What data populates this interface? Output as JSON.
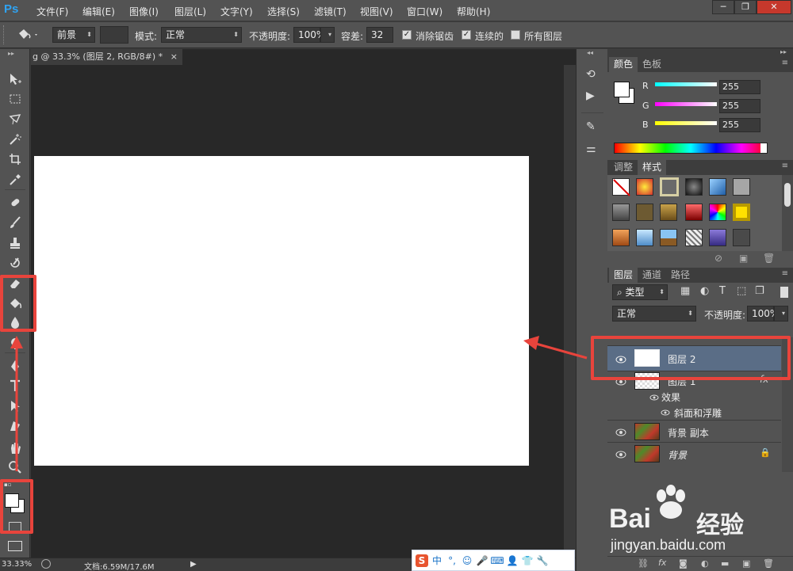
{
  "app": {
    "logo": "Ps",
    "menu": [
      "文件(F)",
      "编辑(E)",
      "图像(I)",
      "图层(L)",
      "文字(Y)",
      "选择(S)",
      "滤镜(T)",
      "视图(V)",
      "窗口(W)",
      "帮助(H)"
    ],
    "window_controls": [
      "─",
      "❐",
      "✕"
    ]
  },
  "options": {
    "fill_source": "前景",
    "mode_label": "模式:",
    "mode_value": "正常",
    "opacity_label": "不透明度:",
    "opacity_value": "100%",
    "tolerance_label": "容差:",
    "tolerance_value": "32",
    "antialias_label": "消除锯齿",
    "antialias_checked": true,
    "contiguous_label": "连续的",
    "contiguous_checked": true,
    "all_layers_label": "所有图层",
    "all_layers_checked": false
  },
  "document": {
    "tab_title": "g @ 33.3% (图层 2, RGB/8#) *",
    "tab_close": "×",
    "zoom": "33.33%",
    "doc_info": "文档:6.59M/17.6M"
  },
  "color_panel": {
    "tabs": [
      "颜色",
      "色板"
    ],
    "channels": [
      {
        "label": "R",
        "value": "255",
        "gradient": "linear-gradient(to right, #00ffff, #ffffff)"
      },
      {
        "label": "G",
        "value": "255",
        "gradient": "linear-gradient(to right, #ff00ff, #ffffff)"
      },
      {
        "label": "B",
        "value": "255",
        "gradient": "linear-gradient(to right, #ffff00, #ffffff)"
      }
    ]
  },
  "styles_panel": {
    "tabs": [
      "调整",
      "样式"
    ]
  },
  "layers_panel": {
    "tabs": [
      "图层",
      "通道",
      "路径"
    ],
    "filter_label": "类型",
    "blend_mode": "正常",
    "opacity_label": "不透明度:",
    "opacity_value": "100%",
    "layers": [
      {
        "name": "图层 2",
        "selected": true
      },
      {
        "name": "图层 1",
        "fx": "fx"
      },
      {
        "name": "效果",
        "sub": true
      },
      {
        "name": "斜面和浮雕",
        "sub": true
      },
      {
        "name": "背景 副本"
      },
      {
        "name": "背景",
        "locked": true
      }
    ]
  },
  "ime": {
    "label": "中"
  },
  "watermark": {
    "brand": "Bai",
    "brand_suffix": "经验",
    "url": "jingyan.baidu.com"
  },
  "colors": {
    "annotation_red": "#e8443c",
    "panel_bg": "#535353",
    "workspace_bg": "#282828",
    "selected_layer": "#5a6d86"
  }
}
